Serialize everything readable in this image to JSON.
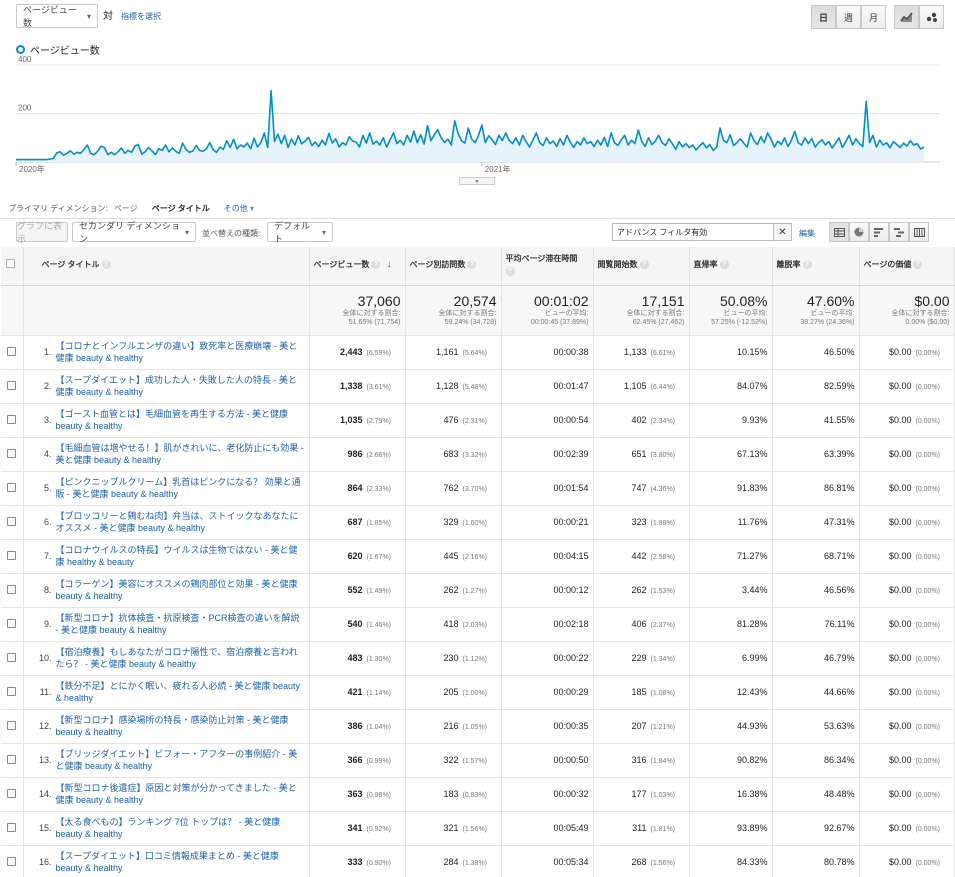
{
  "top": {
    "metric_select": "ページビュー数",
    "vs_label": "対",
    "select_metric_link": "指標を選択",
    "period_buttons": [
      "日",
      "週",
      "月"
    ],
    "active_period": 0
  },
  "legend": {
    "metric_name": "ページビュー数",
    "color": "#058dc7"
  },
  "chart_data": {
    "type": "area",
    "y_ticks": [
      400,
      200
    ],
    "ylim": [
      0,
      400
    ],
    "x_labels": [
      "2020年",
      "2021年"
    ],
    "values": [
      10,
      10,
      10,
      10,
      10,
      10,
      10,
      10,
      10,
      10,
      12,
      15,
      38,
      42,
      28,
      36,
      46,
      32,
      40,
      36,
      52,
      70,
      35,
      30,
      44,
      65,
      60,
      30,
      40,
      30,
      42,
      58,
      36,
      48,
      40,
      66,
      72,
      32,
      42,
      60,
      46,
      30,
      55,
      48,
      70,
      42,
      58,
      44,
      36,
      78,
      52,
      40,
      45,
      68,
      48,
      44,
      55,
      80,
      50,
      40,
      62,
      52,
      88,
      60,
      94,
      54,
      70,
      62,
      78,
      54,
      98,
      62,
      80,
      120,
      60,
      295,
      85,
      115,
      76,
      110,
      60,
      95,
      70,
      108,
      75,
      86,
      102,
      68,
      82,
      64,
      90,
      70,
      118,
      78,
      96,
      62,
      80,
      70,
      104,
      86,
      82,
      62,
      110,
      78,
      120,
      74,
      86,
      70,
      100,
      62,
      92,
      120,
      76,
      90,
      70,
      110,
      82,
      128,
      80,
      112,
      74,
      150,
      88,
      112,
      134,
      100,
      80,
      95,
      70,
      170,
      118,
      88,
      78,
      140,
      95,
      80,
      110,
      152,
      80,
      108,
      92,
      72,
      110,
      88,
      120,
      90,
      76,
      100,
      70,
      110,
      84,
      62,
      90,
      120,
      80,
      68,
      100,
      76,
      86,
      64,
      96,
      70,
      110,
      82,
      60,
      84,
      70,
      100,
      76,
      84,
      64,
      90,
      70,
      102,
      64,
      120,
      80,
      68,
      92,
      110,
      70,
      90,
      76,
      132,
      86,
      64,
      100,
      72,
      86,
      110,
      80,
      68,
      96,
      76,
      52,
      84,
      62,
      76,
      60,
      70,
      50,
      66,
      80,
      58,
      72,
      48,
      60,
      140,
      90,
      80,
      112,
      68,
      80,
      96,
      78,
      62,
      120,
      88,
      72,
      104,
      80,
      120,
      95,
      62,
      86,
      72,
      100,
      64,
      90,
      126,
      80,
      70,
      100,
      76,
      96,
      62,
      80,
      92,
      70,
      84,
      58,
      78,
      100,
      60,
      84,
      110,
      70,
      96,
      76,
      64,
      250,
      80,
      110,
      62,
      90,
      70,
      80,
      58,
      84,
      72,
      60,
      78,
      66,
      88,
      70,
      76,
      54,
      62
    ]
  },
  "dimension_bar": {
    "label": "プライマリ ディメンション:",
    "page": "ページ",
    "page_title": "ページ タイトル",
    "other": "その他"
  },
  "toolbar": {
    "show_graph": "グラフに表示",
    "secondary_dim": "セカンダリ ディメンション",
    "sort_label": "並べ替えの種類:",
    "sort_value": "デフォルト",
    "filter_value": "アドバンス フィルタ有効",
    "edit_link": "編集"
  },
  "columns": [
    "ページ タイトル",
    "ページビュー数",
    "ページ別訪問数",
    "平均ページ滞在時間",
    "閲覧開始数",
    "直帰率",
    "離脱率",
    "ページの価値"
  ],
  "totals": [
    {
      "big": "37,060",
      "sub1": "全体に対する割合:",
      "sub2": "51.65% (71,754)"
    },
    {
      "big": "20,574",
      "sub1": "全体に対する割合:",
      "sub2": "59.24% (34,728)"
    },
    {
      "big": "00:01:02",
      "sub1": "ビューの平均:",
      "sub2": "00:00:45 (37.89%)"
    },
    {
      "big": "17,151",
      "sub1": "全体に対する割合:",
      "sub2": "62.45% (27,462)"
    },
    {
      "big": "50.08%",
      "sub1": "ビューの平均:",
      "sub2": "57.25% (-12.52%)"
    },
    {
      "big": "47.60%",
      "sub1": "ビューの平均:",
      "sub2": "38.27% (24.36%)"
    },
    {
      "big": "$0.00",
      "sub1": "全体に対する割合:",
      "sub2": "0.00% ($0.00)"
    }
  ],
  "rows": [
    {
      "idx": "1.",
      "title": "【コロナとインフルエンザの違い】致死率と医療崩壊 - 美と健康 beauty & healthy",
      "pv": "2,443",
      "pv_pct": "(6.59%)",
      "visits": "1,161",
      "visits_pct": "(5.64%)",
      "avg": "00:00:38",
      "ent": "1,133",
      "ent_pct": "(6.61%)",
      "bounce": "10.15%",
      "exit": "46.50%",
      "val": "$0.00",
      "val_pct": "(0.00%)"
    },
    {
      "idx": "2.",
      "title": "【スープダイエット】成功した人・失敗した人の特長 - 美と健康 beauty & healthy",
      "pv": "1,338",
      "pv_pct": "(3.61%)",
      "visits": "1,128",
      "visits_pct": "(5.48%)",
      "avg": "00:01:47",
      "ent": "1,105",
      "ent_pct": "(6.44%)",
      "bounce": "84.07%",
      "exit": "82.59%",
      "val": "$0.00",
      "val_pct": "(0.00%)"
    },
    {
      "idx": "3.",
      "title": "【ゴースト血管とは】毛細血管を再生する方法 - 美と健康 beauty & healthy",
      "pv": "1,035",
      "pv_pct": "(2.79%)",
      "visits": "476",
      "visits_pct": "(2.31%)",
      "avg": "00:00:54",
      "ent": "402",
      "ent_pct": "(2.34%)",
      "bounce": "9.93%",
      "exit": "41.55%",
      "val": "$0.00",
      "val_pct": "(0.00%)"
    },
    {
      "idx": "4.",
      "title": "【毛細血管は増やせる！】肌がきれいに、老化防止にも効果 - 美と健康 beauty & healthy",
      "pv": "986",
      "pv_pct": "(2.66%)",
      "visits": "683",
      "visits_pct": "(3.32%)",
      "avg": "00:02:39",
      "ent": "651",
      "ent_pct": "(3.80%)",
      "bounce": "67.13%",
      "exit": "63.39%",
      "val": "$0.00",
      "val_pct": "(0.00%)"
    },
    {
      "idx": "5.",
      "title": "【ピンクニップルクリーム】乳首はピンクになる？ 効果と通販 - 美と健康 beauty & healthy",
      "pv": "864",
      "pv_pct": "(2.33%)",
      "visits": "762",
      "visits_pct": "(3.70%)",
      "avg": "00:01:54",
      "ent": "747",
      "ent_pct": "(4.36%)",
      "bounce": "91.83%",
      "exit": "86.81%",
      "val": "$0.00",
      "val_pct": "(0.00%)"
    },
    {
      "idx": "6.",
      "title": "【ブロッコリーと鶏むね肉】弁当は、ストイックなあなたにオススメ - 美と健康 beauty & healthy",
      "pv": "687",
      "pv_pct": "(1.85%)",
      "visits": "329",
      "visits_pct": "(1.60%)",
      "avg": "00:00:21",
      "ent": "323",
      "ent_pct": "(1.88%)",
      "bounce": "11.76%",
      "exit": "47.31%",
      "val": "$0.00",
      "val_pct": "(0.00%)"
    },
    {
      "idx": "7.",
      "title": "【コロナウイルスの特長】ウイルスは生物ではない - 美と健康 healthy & beauty",
      "pv": "620",
      "pv_pct": "(1.67%)",
      "visits": "445",
      "visits_pct": "(2.16%)",
      "avg": "00:04:15",
      "ent": "442",
      "ent_pct": "(2.58%)",
      "bounce": "71.27%",
      "exit": "68.71%",
      "val": "$0.00",
      "val_pct": "(0.00%)"
    },
    {
      "idx": "8.",
      "title": "【コラーゲン】美容にオススメの鶏肉部位と効果 - 美と健康 beauty & healthy",
      "pv": "552",
      "pv_pct": "(1.49%)",
      "visits": "262",
      "visits_pct": "(1.27%)",
      "avg": "00:00:12",
      "ent": "262",
      "ent_pct": "(1.53%)",
      "bounce": "3.44%",
      "exit": "46.56%",
      "val": "$0.00",
      "val_pct": "(0.00%)"
    },
    {
      "idx": "9.",
      "title": "【新型コロナ】抗体検査・抗原検査・PCR検査の違いを解説 - 美と健康 beauty & healthy",
      "pv": "540",
      "pv_pct": "(1.46%)",
      "visits": "418",
      "visits_pct": "(2.03%)",
      "avg": "00:02:18",
      "ent": "406",
      "ent_pct": "(2.37%)",
      "bounce": "81.28%",
      "exit": "76.11%",
      "val": "$0.00",
      "val_pct": "(0.00%)"
    },
    {
      "idx": "10.",
      "title": "【宿泊療養】もしあなたがコロナ陽性で、宿泊療養と言われたら？ - 美と健康 beauty & healthy",
      "pv": "483",
      "pv_pct": "(1.30%)",
      "visits": "230",
      "visits_pct": "(1.12%)",
      "avg": "00:00:22",
      "ent": "229",
      "ent_pct": "(1.34%)",
      "bounce": "6.99%",
      "exit": "46.79%",
      "val": "$0.00",
      "val_pct": "(0.00%)"
    },
    {
      "idx": "11.",
      "title": "【鉄分不足】とにかく眠い、疲れる人必読 - 美と健康 beauty & healthy",
      "pv": "421",
      "pv_pct": "(1.14%)",
      "visits": "205",
      "visits_pct": "(1.00%)",
      "avg": "00:00:29",
      "ent": "185",
      "ent_pct": "(1.08%)",
      "bounce": "12.43%",
      "exit": "44.66%",
      "val": "$0.00",
      "val_pct": "(0.00%)"
    },
    {
      "idx": "12.",
      "title": "【新型コロナ】感染場所の特長・感染防止対策 - 美と健康 beauty & healthy",
      "pv": "386",
      "pv_pct": "(1.04%)",
      "visits": "216",
      "visits_pct": "(1.05%)",
      "avg": "00:00:35",
      "ent": "207",
      "ent_pct": "(1.21%)",
      "bounce": "44.93%",
      "exit": "53.63%",
      "val": "$0.00",
      "val_pct": "(0.00%)"
    },
    {
      "idx": "13.",
      "title": "【ブリッジダイエット】ビフォー・アフターの事例紹介 - 美と健康 beauty & healthy",
      "pv": "366",
      "pv_pct": "(0.99%)",
      "visits": "322",
      "visits_pct": "(1.57%)",
      "avg": "00:00:50",
      "ent": "316",
      "ent_pct": "(1.84%)",
      "bounce": "90.82%",
      "exit": "86.34%",
      "val": "$0.00",
      "val_pct": "(0.00%)"
    },
    {
      "idx": "14.",
      "title": "【新型コロナ後遺症】原因と対策が分かってきました - 美と健康 beauty & healthy",
      "pv": "363",
      "pv_pct": "(0.98%)",
      "visits": "183",
      "visits_pct": "(0.89%)",
      "avg": "00:00:32",
      "ent": "177",
      "ent_pct": "(1.03%)",
      "bounce": "16.38%",
      "exit": "48.48%",
      "val": "$0.00",
      "val_pct": "(0.00%)"
    },
    {
      "idx": "15.",
      "title": "【太る食べもの】ランキング 7位 トップは？ - 美と健康 beauty & healthy",
      "pv": "341",
      "pv_pct": "(0.92%)",
      "visits": "321",
      "visits_pct": "(1.56%)",
      "avg": "00:05:49",
      "ent": "311",
      "ent_pct": "(1.81%)",
      "bounce": "93.89%",
      "exit": "92.67%",
      "val": "$0.00",
      "val_pct": "(0.00%)"
    },
    {
      "idx": "16.",
      "title": "【スープダイエット】口コミ情報成果まとめ - 美と健康 beauty & healthy",
      "pv": "333",
      "pv_pct": "(0.90%)",
      "visits": "284",
      "visits_pct": "(1.38%)",
      "avg": "00:05:34",
      "ent": "268",
      "ent_pct": "(1.56%)",
      "bounce": "84.33%",
      "exit": "80.78%",
      "val": "$0.00",
      "val_pct": "(0.00%)"
    }
  ]
}
